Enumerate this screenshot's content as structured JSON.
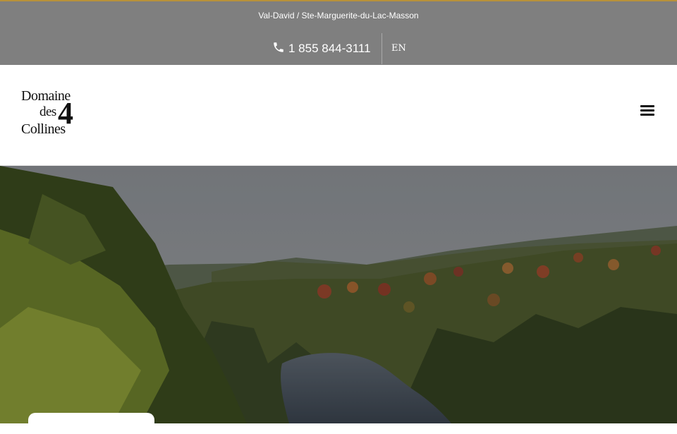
{
  "topbar": {
    "location": "Val-David / Ste-Marguerite-du-Lac-Masson",
    "phone": "1 855 844-3111",
    "language": "EN",
    "accent_color": "#b8913a",
    "background_color": "#7f7f7f"
  },
  "header": {
    "logo": {
      "line1": "Domaine",
      "line2": "des",
      "number": "4",
      "line3": "Collines"
    },
    "menu_icon": "hamburger-icon"
  },
  "hero": {
    "image_description": "aerial-forest-lake-icon"
  }
}
